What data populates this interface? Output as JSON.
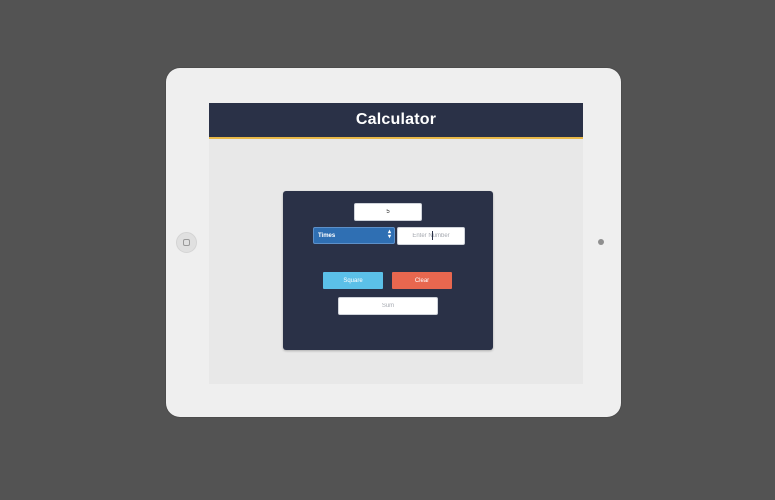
{
  "app": {
    "title": "Calculator"
  },
  "calculator": {
    "first_number_value": "5",
    "operation": {
      "selected": "Times"
    },
    "second_number_placeholder": "Enter Number",
    "square_label": "Square",
    "clear_label": "Clear",
    "sum_placeholder": "Sum"
  },
  "colors": {
    "background": "#535353",
    "device": "#efefef",
    "header": "#2a3147",
    "header_accent": "#e9b949",
    "select": "#2f6fb3",
    "square_button": "#5bc0e8",
    "clear_button": "#e8674f"
  }
}
